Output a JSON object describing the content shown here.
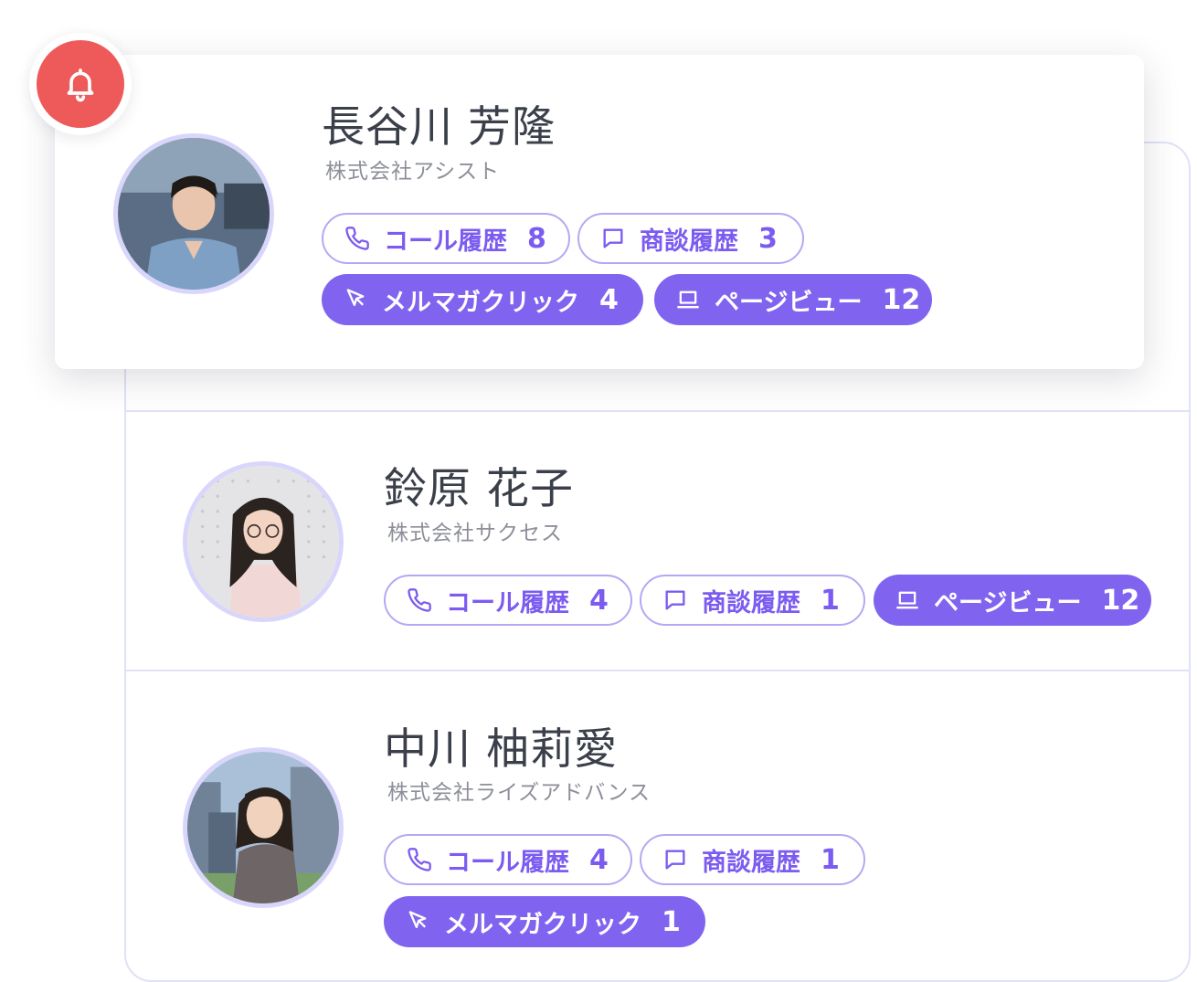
{
  "colors": {
    "accent": "#8064f0",
    "accent_outline": "#b8a6f4",
    "notification": "#ee5959",
    "panel_border": "#dfe2f6"
  },
  "notification": {
    "icon": "bell-icon"
  },
  "contacts": [
    {
      "name": "長谷川 芳隆",
      "company": "株式会社アシスト",
      "badges": [
        {
          "icon": "phone-icon",
          "label": "コール履歴",
          "count": "8",
          "style": "outline"
        },
        {
          "icon": "chat-icon",
          "label": "商談履歴",
          "count": "3",
          "style": "outline"
        },
        {
          "icon": "cursor-icon",
          "label": "メルマガクリック",
          "count": "4",
          "style": "filled"
        },
        {
          "icon": "laptop-icon",
          "label": "ページビュー",
          "count": "12",
          "style": "filled"
        }
      ]
    },
    {
      "name": "鈴原 花子",
      "company": "株式会社サクセス",
      "badges": [
        {
          "icon": "phone-icon",
          "label": "コール履歴",
          "count": "4",
          "style": "outline"
        },
        {
          "icon": "chat-icon",
          "label": "商談履歴",
          "count": "1",
          "style": "outline"
        },
        {
          "icon": "laptop-icon",
          "label": "ページビュー",
          "count": "12",
          "style": "filled"
        }
      ]
    },
    {
      "name": "中川 柚莉愛",
      "company": "株式会社ライズアドバンス",
      "badges": [
        {
          "icon": "phone-icon",
          "label": "コール履歴",
          "count": "4",
          "style": "outline"
        },
        {
          "icon": "chat-icon",
          "label": "商談履歴",
          "count": "1",
          "style": "outline"
        },
        {
          "icon": "cursor-icon",
          "label": "メルマガクリック",
          "count": "1",
          "style": "filled"
        }
      ]
    }
  ]
}
